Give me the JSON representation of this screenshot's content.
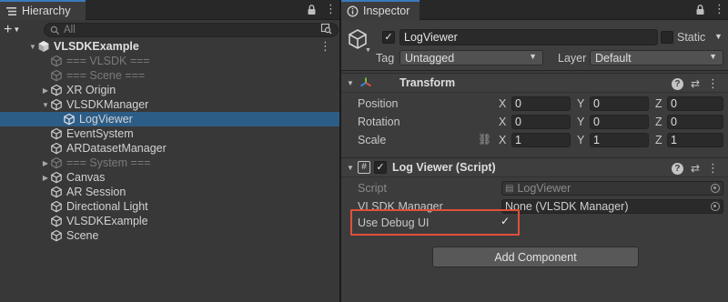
{
  "hierarchy": {
    "tab_label": "Hierarchy",
    "add_label": "+",
    "search_placeholder": "All",
    "root": "VLSDKExample",
    "items": [
      {
        "label": "=== VLSDK ===",
        "dim": true
      },
      {
        "label": "=== Scene ===",
        "dim": true
      },
      {
        "label": "XR Origin"
      },
      {
        "label": "VLSDKManager"
      },
      {
        "label": "LogViewer",
        "selected": true
      },
      {
        "label": "EventSystem"
      },
      {
        "label": "ARDatasetManager"
      },
      {
        "label": "=== System ===",
        "dim": true
      },
      {
        "label": "Canvas"
      },
      {
        "label": "AR Session"
      },
      {
        "label": "Directional Light"
      },
      {
        "label": "VLSDKExample"
      },
      {
        "label": "Scene"
      }
    ]
  },
  "inspector": {
    "tab_label": "Inspector",
    "object_name": "LogViewer",
    "static_label": "Static",
    "tag_label": "Tag",
    "tag_value": "Untagged",
    "layer_label": "Layer",
    "layer_value": "Default",
    "transform": {
      "title": "Transform",
      "rows": [
        {
          "label": "Position",
          "x": "0",
          "y": "0",
          "z": "0"
        },
        {
          "label": "Rotation",
          "x": "0",
          "y": "0",
          "z": "0"
        },
        {
          "label": "Scale",
          "x": "1",
          "y": "1",
          "z": "1"
        }
      ],
      "axes": [
        "X",
        "Y",
        "Z"
      ]
    },
    "script_component": {
      "title": "Log Viewer (Script)",
      "script_label": "Script",
      "script_value": "LogViewer",
      "manager_label": "VLSDK Manager",
      "manager_value": "None (VLSDK Manager)",
      "debug_label": "Use Debug UI",
      "debug_checked": "✓"
    },
    "add_component": "Add Component"
  },
  "colors": {
    "selection": "#2c5d87",
    "highlight_box": "#e0503a",
    "active_tab_accent": "#3a79bb"
  }
}
